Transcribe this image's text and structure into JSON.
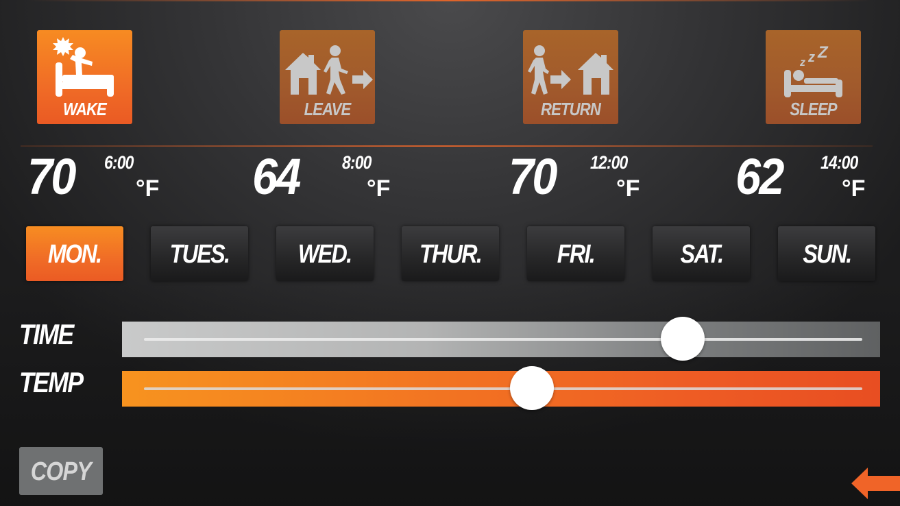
{
  "colors": {
    "accent": "#f06c26",
    "accent_light": "#f78d22",
    "background": "#2a2a2b",
    "inactive_tile": "#a15a2c",
    "icon_inactive": "#c8c8c8",
    "copy_button": "#6f7172",
    "back_arrow": "#f06428"
  },
  "modes": [
    {
      "label": "WAKE",
      "icon": "wake-icon",
      "active": true
    },
    {
      "label": "LEAVE",
      "icon": "leave-home-icon",
      "active": false
    },
    {
      "label": "RETURN",
      "icon": "return-home-icon",
      "active": false
    },
    {
      "label": "SLEEP",
      "icon": "sleep-icon",
      "active": false
    }
  ],
  "schedule": [
    {
      "temp": "70",
      "time": "6:00",
      "unit": "°F"
    },
    {
      "temp": "64",
      "time": "8:00",
      "unit": "°F"
    },
    {
      "temp": "70",
      "time": "12:00",
      "unit": "°F"
    },
    {
      "temp": "62",
      "time": "14:00",
      "unit": "°F"
    }
  ],
  "days": [
    {
      "label": "MON.",
      "active": true
    },
    {
      "label": "TUES.",
      "active": false
    },
    {
      "label": "WED.",
      "active": false
    },
    {
      "label": "THUR.",
      "active": false
    },
    {
      "label": "FRI.",
      "active": false
    },
    {
      "label": "SAT.",
      "active": false
    },
    {
      "label": "SUN.",
      "active": false
    }
  ],
  "sliders": {
    "time": {
      "label": "TIME",
      "value_fraction": 0.75
    },
    "temp": {
      "label": "TEMP",
      "value_fraction": 0.54
    }
  },
  "copy_label": "COPY",
  "back_icon": "back-arrow-icon"
}
